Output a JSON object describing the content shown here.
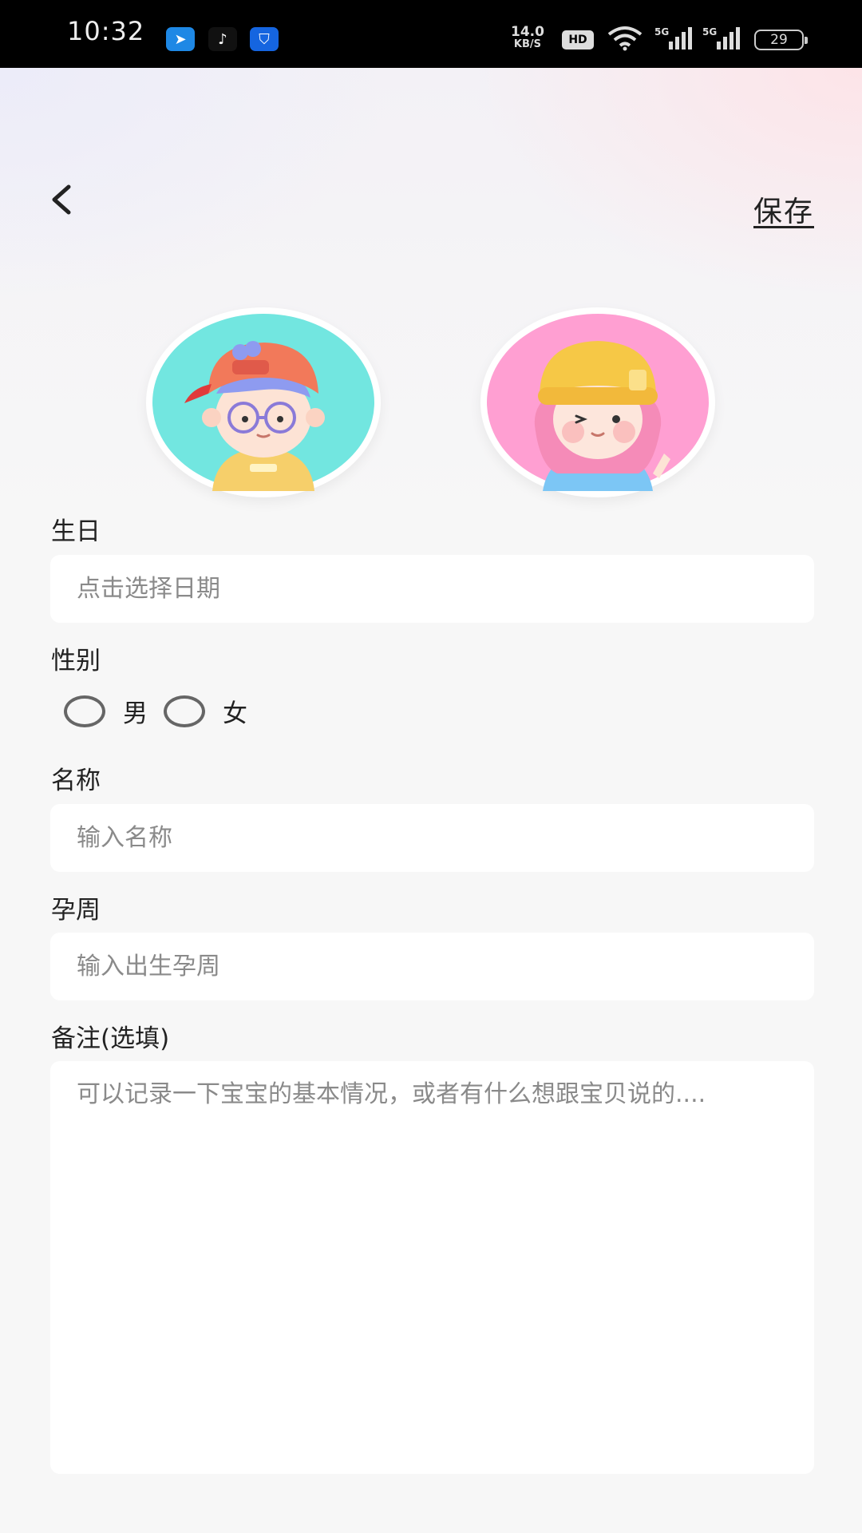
{
  "status_bar": {
    "time": "10:32",
    "speed_value": "14.0",
    "speed_unit": "KB/S",
    "hd": "HD",
    "net1": "5G",
    "net2": "5G",
    "battery": "29",
    "app_icons": [
      "message-app-icon",
      "tiktok-icon",
      "security-app-icon"
    ]
  },
  "header": {
    "save_label": "保存"
  },
  "avatars": {
    "boy_color": "#72e6e0",
    "girl_color": "#ff9fd2"
  },
  "form": {
    "birthday_label": "生日",
    "birthday_placeholder": "点击选择日期",
    "gender_label": "性别",
    "gender_options": [
      "男",
      "女"
    ],
    "name_label": "名称",
    "name_placeholder": "输入名称",
    "gestation_label": "孕周",
    "gestation_placeholder": "输入出生孕周",
    "notes_label": "备注(选填)",
    "notes_placeholder": "可以记录一下宝宝的基本情况，或者有什么想跟宝贝说的...."
  }
}
